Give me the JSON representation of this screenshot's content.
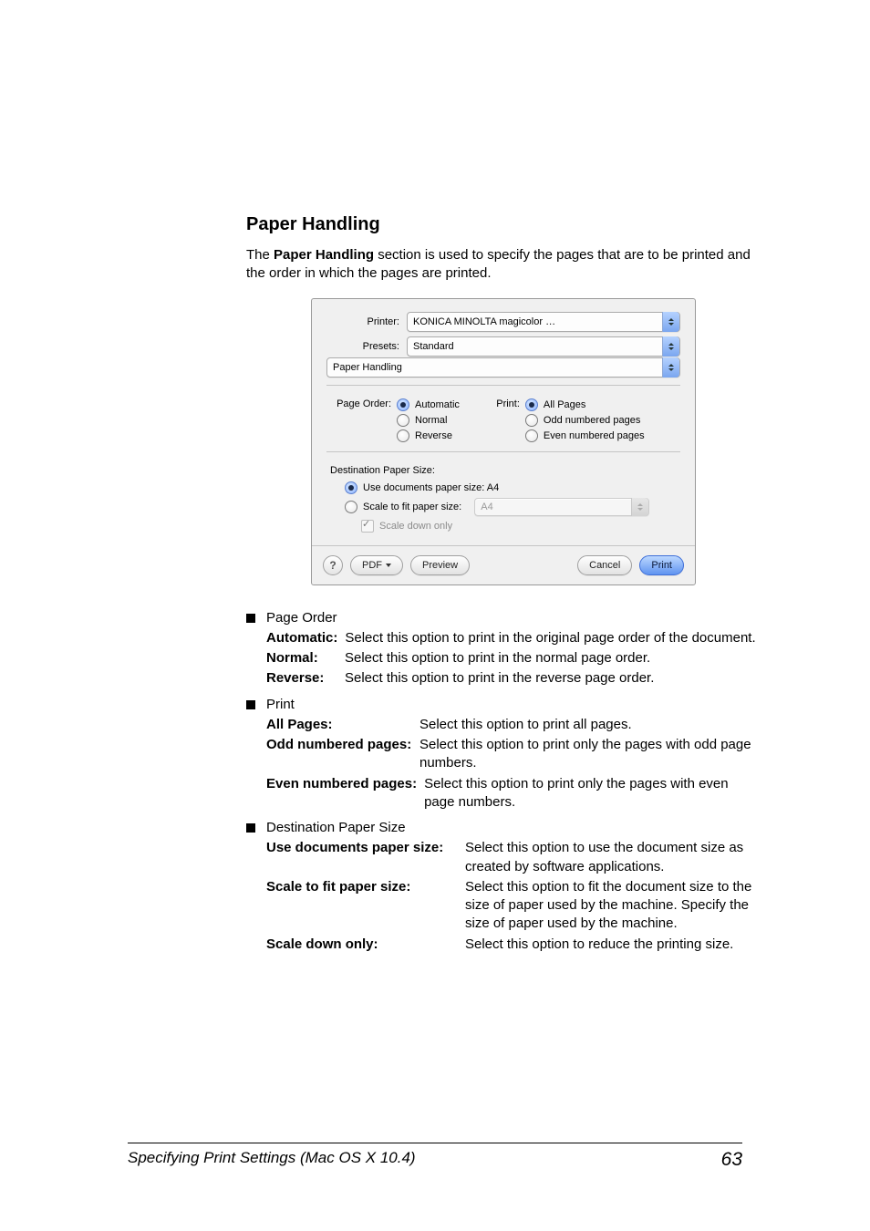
{
  "section_title": "Paper Handling",
  "intro_before_bold": "The ",
  "intro_bold": "Paper Handling",
  "intro_after_bold": " section is used to specify the pages that are to be printed and the order in which the pages are printed.",
  "dialog": {
    "printer_label": "Printer:",
    "printer_value": "KONICA MINOLTA magicolor …",
    "presets_label": "Presets:",
    "presets_value": "Standard",
    "section_value": "Paper Handling",
    "page_order_label": "Page Order:",
    "po_auto": "Automatic",
    "po_normal": "Normal",
    "po_reverse": "Reverse",
    "print_label": "Print:",
    "pr_all": "All Pages",
    "pr_odd": "Odd numbered pages",
    "pr_even": "Even numbered pages",
    "dest_title": "Destination Paper Size:",
    "dest_use_doc": "Use documents paper size:  A4",
    "dest_scale": "Scale to fit paper size:",
    "dest_scale_value": "A4",
    "dest_scale_down": "Scale down only",
    "help": "?",
    "pdf": "PDF",
    "preview": "Preview",
    "cancel": "Cancel",
    "print": "Print"
  },
  "body": {
    "page_order_heading": "Page Order",
    "po_items": {
      "auto_term": "Automatic",
      "auto_desc": "Select this option to print in the original page order of the document.",
      "normal_term": "Normal",
      "normal_desc": "Select this option to print in the normal page order.",
      "reverse_term": "Reverse",
      "reverse_desc": "Select this option to print in the reverse page order."
    },
    "print_heading": "Print",
    "print_items": {
      "all_term": "All Pages",
      "all_desc": "Select this option to print all pages.",
      "odd_term": "Odd numbered pages",
      "odd_desc": "Select this option to print only the pages with odd page numbers.",
      "even_term": "Even numbered pages",
      "even_desc": "Select this option to print only the pages with even page numbers."
    },
    "dest_heading": "Destination Paper Size",
    "dest_items": {
      "use_term": "Use documents paper size",
      "use_desc": "Select this option to use the document size as created by software applications.",
      "scale_term": "Scale to fit paper size",
      "scale_desc": "Select this option to fit the document size to the size of paper used by the machine. Specify the size of paper used by the machine.",
      "down_term": "Scale down only",
      "down_desc": "Select this option to reduce the printing size."
    }
  },
  "footer": {
    "left": "Specifying Print Settings (Mac OS X 10.4)",
    "right": "63"
  },
  "colon": ":"
}
